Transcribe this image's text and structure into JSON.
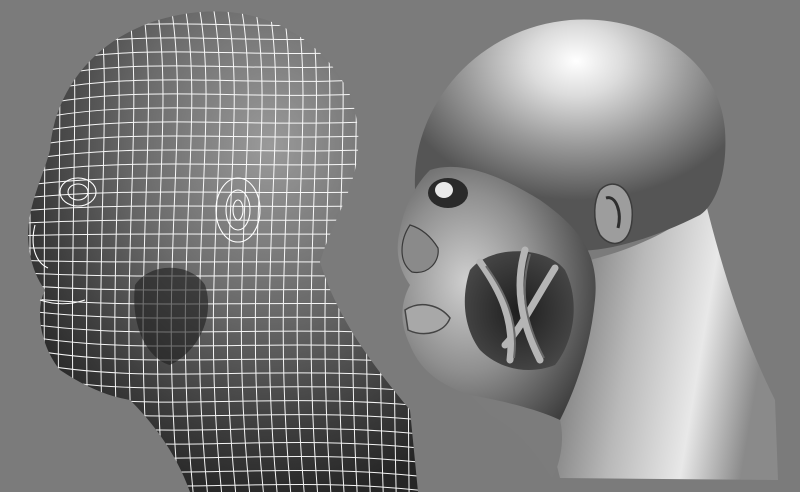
{
  "scene": {
    "background": "#7b7b7b",
    "wire_color": "#ffffff",
    "models": [
      {
        "name": "wireframe-head",
        "render_mode": "wireframe",
        "view": "left-profile"
      },
      {
        "name": "shaded-head",
        "render_mode": "smooth-shaded",
        "view": "left-profile"
      }
    ]
  }
}
